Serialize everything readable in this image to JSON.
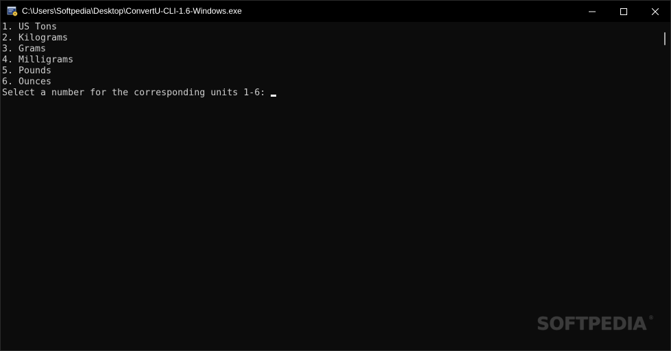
{
  "window": {
    "title": "C:\\Users\\Softpedia\\Desktop\\ConvertU-CLI-1.6-Windows.exe",
    "icon": "console-app-icon"
  },
  "controls": {
    "minimize_icon": "minimize-icon",
    "maximize_icon": "maximize-icon",
    "close_icon": "close-icon"
  },
  "console": {
    "lines": [
      "1. US Tons",
      "2. Kilograms",
      "3. Grams",
      "4. Milligrams",
      "5. Pounds",
      "6. Ounces",
      "Select a number for the corresponding units 1-6: "
    ]
  },
  "watermark": {
    "text": "SOFTPEDIA",
    "mark": "®"
  },
  "colors": {
    "background": "#0c0c0c",
    "titlebar": "#000000",
    "text": "#cccccc",
    "cursor": "#ffffff"
  }
}
